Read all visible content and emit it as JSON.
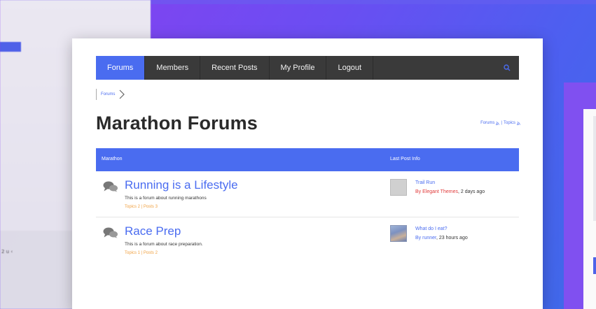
{
  "background": {
    "left_tiny_text": "2 u ‹"
  },
  "nav": {
    "items": [
      {
        "label": "Forums",
        "active": true
      },
      {
        "label": "Members",
        "active": false
      },
      {
        "label": "Recent Posts",
        "active": false
      },
      {
        "label": "My Profile",
        "active": false
      },
      {
        "label": "Logout",
        "active": false
      }
    ]
  },
  "breadcrumb": {
    "items": [
      "Forums"
    ]
  },
  "page": {
    "title": "Marathon Forums",
    "feeds": {
      "forums": "Forums",
      "separator": "|",
      "topics": "Topics"
    }
  },
  "table": {
    "columns": {
      "forum": "Marathon",
      "last_post": "Last Post Info"
    },
    "rows": [
      {
        "name": "Running is a Lifestyle",
        "description": "This is a forum about running marathons",
        "topics": "Topics 2",
        "separator": "|",
        "posts": "Posts 3",
        "last_post_title": "Trail Run",
        "last_post_by": "By Elegant Themes",
        "last_post_time": ", 2 days  ago"
      },
      {
        "name": "Race Prep",
        "description": "This is a forum about race preparation.",
        "topics": "Topics 1",
        "separator": "|",
        "posts": "Posts 2",
        "last_post_title": "What do I eat?",
        "last_post_by": "By runner",
        "last_post_time": ", 23 hours  ago"
      }
    ]
  },
  "colors": {
    "accent": "#4a6cf0",
    "nav_bg": "#3a3a3a",
    "counts": "#f0a040",
    "author_red": "#e03a3a"
  }
}
